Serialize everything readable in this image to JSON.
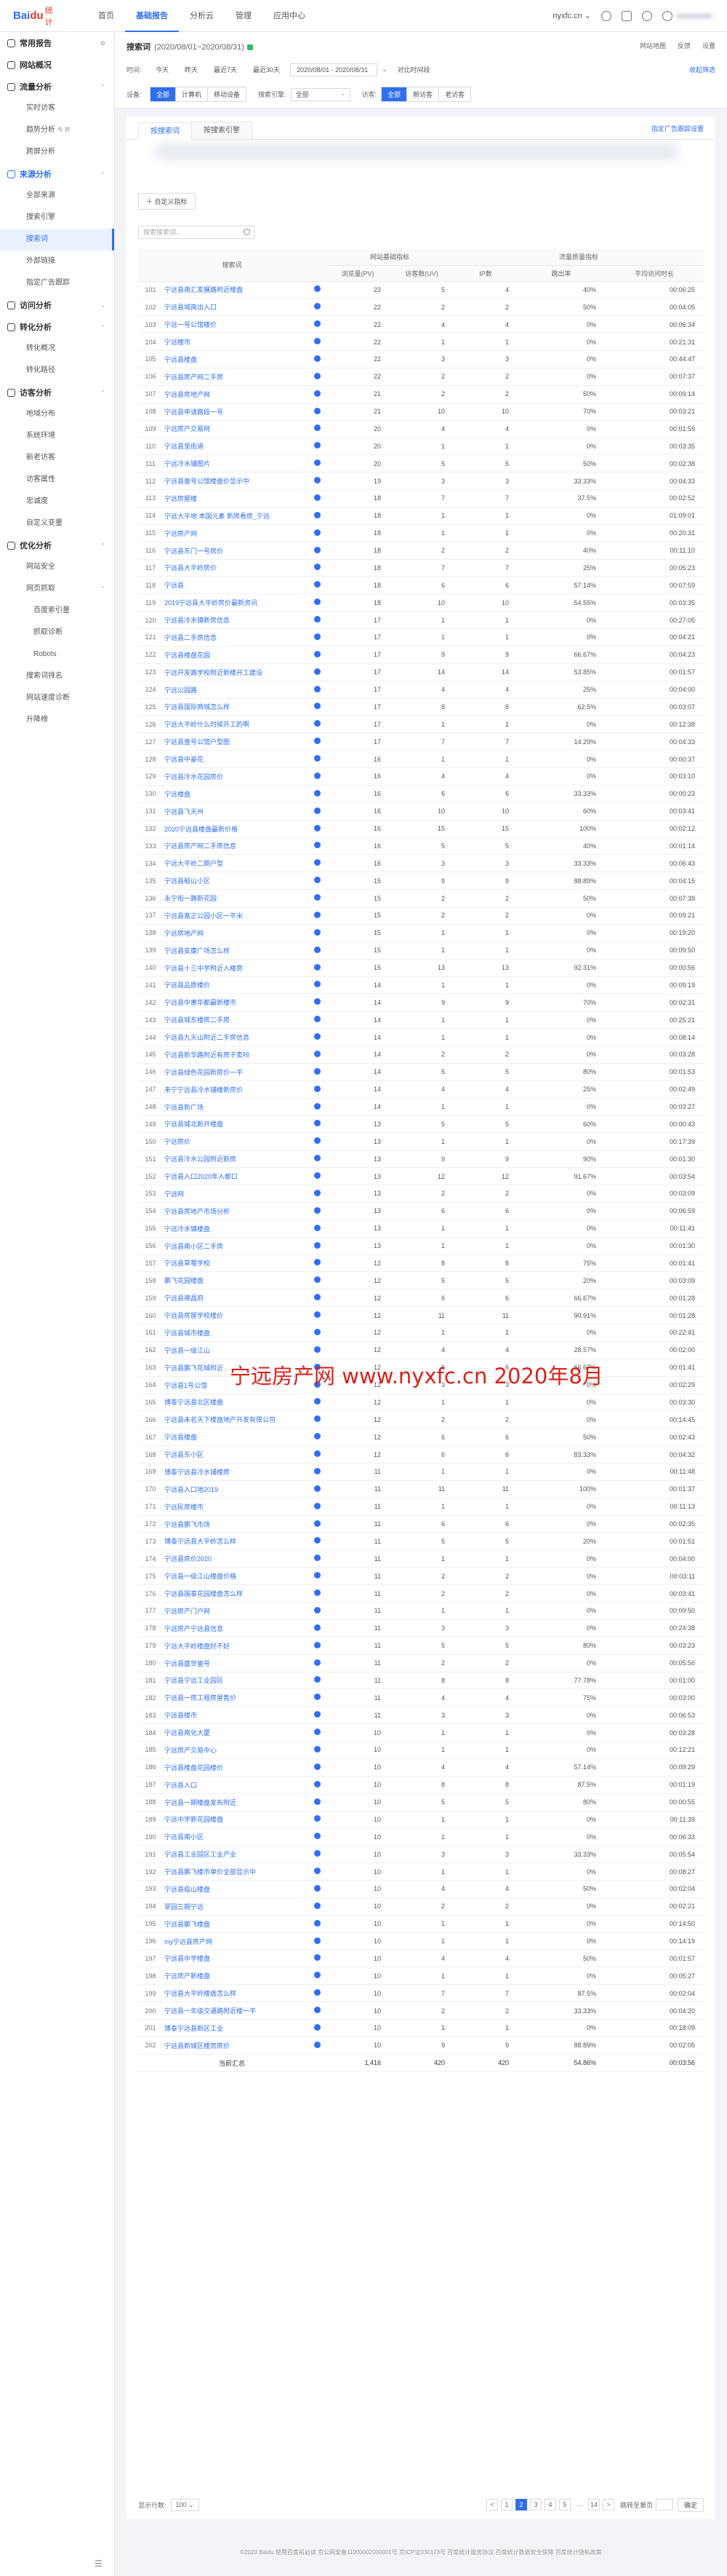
{
  "header": {
    "logo_text": "Bai",
    "logo_text2": "du",
    "logo_sub": "统计",
    "nav": [
      "首页",
      "基础报告",
      "分析云",
      "管理",
      "应用中心"
    ],
    "site": "nyxfc.cn",
    "accent": "#2f6ff0"
  },
  "sidebar": {
    "sections": [
      {
        "label": "常用报告",
        "items": []
      },
      {
        "label": "网站概况",
        "items": []
      },
      {
        "label": "流量分析",
        "items": [
          "实时访客",
          "趋势分析",
          "跨屏分析"
        ]
      },
      {
        "label": "来源分析",
        "items": [
          "全部来源",
          "搜索引擎",
          "搜索词",
          "外部链接",
          "指定广告跟踪"
        ]
      },
      {
        "label": "访问分析",
        "items": []
      },
      {
        "label": "转化分析",
        "items": [
          "转化概况",
          "转化路径"
        ]
      },
      {
        "label": "访客分析",
        "items": [
          "地域分布",
          "系统环境",
          "新老访客",
          "访客属性",
          "忠诚度",
          "自定义变量"
        ]
      },
      {
        "label": "优化分析",
        "items": [
          "网站安全",
          "网页抓取",
          "百度索引量",
          "抓取诊断",
          "Robots",
          "搜索词排名",
          "网站速度诊断",
          "升降榜"
        ]
      }
    ],
    "trend_badge": "今 昨"
  },
  "filter": {
    "title": "搜索词",
    "range": "(2020/08/01~2020/08/31)",
    "right_links": [
      "网站地图",
      "反馈",
      "设置"
    ],
    "time_label": "时间:",
    "time_chips": [
      "今天",
      "昨天",
      "最近7天",
      "最近30天"
    ],
    "date_value": "2020/08/01 - 2020/08/31",
    "compare": "对比时间段",
    "collapse": "收起筛选",
    "device_label": "设备:",
    "device_chips": [
      "全部",
      "计算机",
      "移动设备"
    ],
    "engine_label": "搜索引擎:",
    "engine_value": "全部",
    "visitor_label": "访客:",
    "visitor_chips": [
      "全部",
      "新访客",
      "老访客"
    ]
  },
  "tabs": [
    "按搜索词",
    "按搜索引擎"
  ],
  "tab_right": "指定广告跟踪设置",
  "export_button": "自定义指标",
  "search_placeholder": "搜索搜索词...",
  "table": {
    "group_headers": [
      "网站基础指标",
      "流量质量指标"
    ],
    "headers": [
      "搜索词",
      "浏览量(PV)",
      "访客数(UV)",
      "IP数",
      "跳出率",
      "平均访问时长"
    ],
    "rows": [
      [
        "101",
        "宁远县南汇发展路附近楼盘",
        "23",
        "5",
        "4",
        "40%",
        "00:06:25"
      ],
      [
        "102",
        "宁远县城南出入口",
        "22",
        "2",
        "2",
        "50%",
        "00:04:05"
      ],
      [
        "103",
        "宁远一号公馆楼价",
        "22",
        "4",
        "4",
        "0%",
        "00:06:34"
      ],
      [
        "104",
        "宁远楼市",
        "22",
        "1",
        "1",
        "0%",
        "00:21:31"
      ],
      [
        "105",
        "宁远县楼盘",
        "22",
        "3",
        "3",
        "0%",
        "00:44:47"
      ],
      [
        "106",
        "宁远县房产网二手房",
        "22",
        "2",
        "2",
        "0%",
        "00:07:37"
      ],
      [
        "107",
        "宁远县房地产网",
        "21",
        "2",
        "2",
        "50%",
        "00:09:14"
      ],
      [
        "108",
        "宁远县申请路段一号",
        "21",
        "10",
        "10",
        "70%",
        "00:03:21"
      ],
      [
        "109",
        "宁远房产交易网",
        "20",
        "4",
        "4",
        "0%",
        "00:01:59"
      ],
      [
        "110",
        "宁远县里街道",
        "20",
        "1",
        "1",
        "0%",
        "00:03:35"
      ],
      [
        "111",
        "宁远冷水铺图片",
        "20",
        "5",
        "5",
        "50%",
        "00:02:38"
      ],
      [
        "112",
        "宁远县壹号公馆楼盘价显示中",
        "19",
        "3",
        "3",
        "33.33%",
        "00:04:33"
      ],
      [
        "113",
        "宁远房屋楼",
        "18",
        "7",
        "7",
        "37.5%",
        "00:02:52"
      ],
      [
        "114",
        "宁远大平地 本国元素 新房看房_宁远",
        "18",
        "1",
        "1",
        "0%",
        "01:09:01"
      ],
      [
        "115",
        "宁远房产网",
        "18",
        "1",
        "1",
        "0%",
        "00:20:31"
      ],
      [
        "116",
        "宁远县东门一号房价",
        "18",
        "2",
        "2",
        "40%",
        "00:11:10"
      ],
      [
        "117",
        "宁远县大平岭房价",
        "18",
        "7",
        "7",
        "25%",
        "00:05:23"
      ],
      [
        "118",
        "宁远县",
        "18",
        "6",
        "6",
        "57.14%",
        "00:07:59"
      ],
      [
        "119",
        "2019宁远县大平岭房价最新资讯",
        "18",
        "10",
        "10",
        "54.55%",
        "00:03:35"
      ],
      [
        "120",
        "宁远县冷水镇新房信息",
        "17",
        "1",
        "1",
        "0%",
        "00:27:05"
      ],
      [
        "121",
        "宁远县二手房信息",
        "17",
        "1",
        "1",
        "0%",
        "00:04:21"
      ],
      [
        "122",
        "宁远县楼盘花园",
        "17",
        "9",
        "9",
        "66.67%",
        "00:04:23"
      ],
      [
        "123",
        "宁远开发路学校附近新楼开工建设",
        "17",
        "14",
        "14",
        "53.85%",
        "00:01:57"
      ],
      [
        "124",
        "宁远公园路",
        "17",
        "4",
        "4",
        "25%",
        "00:04:00"
      ],
      [
        "125",
        "宁远县国际商城怎么样",
        "17",
        "8",
        "8",
        "62.5%",
        "00:03:07"
      ],
      [
        "126",
        "宁远大平岭什么时候开工的啊",
        "17",
        "1",
        "1",
        "0%",
        "00:12:38"
      ],
      [
        "127",
        "宁远县壹号公馆户型图",
        "17",
        "7",
        "7",
        "14.29%",
        "00:04:33"
      ],
      [
        "128",
        "宁远县中豪花",
        "16",
        "1",
        "1",
        "0%",
        "00:00:37"
      ],
      [
        "129",
        "宁远县冷水花园房价",
        "16",
        "4",
        "4",
        "0%",
        "00:03:10"
      ],
      [
        "130",
        "宁远楼盘",
        "16",
        "6",
        "6",
        "33.33%",
        "00:00:23"
      ],
      [
        "131",
        "宁远县飞天州",
        "16",
        "10",
        "10",
        "60%",
        "00:03:41"
      ],
      [
        "132",
        "2020宁远县楼盘最新价格",
        "16",
        "15",
        "15",
        "100%",
        "00:02:12"
      ],
      [
        "133",
        "宁远县房产网二手房信息",
        "16",
        "5",
        "5",
        "40%",
        "00:01:14"
      ],
      [
        "134",
        "宁远大平岭二期户型",
        "16",
        "3",
        "3",
        "33.33%",
        "00:06:43"
      ],
      [
        "135",
        "宁远县船山小区",
        "15",
        "9",
        "9",
        "88.89%",
        "00:04:15"
      ],
      [
        "136",
        "永宁街一路新花园",
        "15",
        "2",
        "2",
        "50%",
        "00:07:39"
      ],
      [
        "137",
        "宁远县富正公园小区一平米",
        "15",
        "2",
        "2",
        "0%",
        "00:09:21"
      ],
      [
        "138",
        "宁远房地产网",
        "15",
        "1",
        "1",
        "0%",
        "00:19:20"
      ],
      [
        "139",
        "宁远县安康广场怎么样",
        "15",
        "1",
        "1",
        "0%",
        "00:09:50"
      ],
      [
        "140",
        "宁远县十三中学附近入楼房",
        "15",
        "13",
        "13",
        "92.31%",
        "00:00:56"
      ],
      [
        "141",
        "宁远县品质楼价",
        "14",
        "1",
        "1",
        "0%",
        "00:09:19"
      ],
      [
        "142",
        "宁远县中惠华都最新楼市",
        "14",
        "9",
        "9",
        "70%",
        "00:02:31"
      ],
      [
        "143",
        "宁远县城东楼房二手房",
        "14",
        "1",
        "1",
        "0%",
        "00:25:21"
      ],
      [
        "144",
        "宁远县九天山附近二手房信息",
        "14",
        "1",
        "1",
        "0%",
        "00:08:14"
      ],
      [
        "145",
        "宁远县新华路附近有房子卖吗",
        "14",
        "2",
        "2",
        "0%",
        "00:03:28"
      ],
      [
        "146",
        "宁远县绿色花园新房价一平",
        "14",
        "5",
        "5",
        "80%",
        "00:01:53"
      ],
      [
        "147",
        "来宁宁远县冷水铺楼新房价",
        "14",
        "4",
        "4",
        "25%",
        "00:02:49"
      ],
      [
        "148",
        "宁远县新广场",
        "14",
        "1",
        "1",
        "0%",
        "00:03:27"
      ],
      [
        "149",
        "宁远县城北新开楼盘",
        "13",
        "5",
        "5",
        "60%",
        "00:00:43"
      ],
      [
        "150",
        "宁远房价",
        "13",
        "1",
        "1",
        "0%",
        "00:17:39"
      ],
      [
        "151",
        "宁远县冷水公园附近新房",
        "13",
        "9",
        "9",
        "90%",
        "00:01:30"
      ],
      [
        "152",
        "宁远县入口2020年入都口",
        "13",
        "12",
        "12",
        "91.67%",
        "00:03:54"
      ],
      [
        "153",
        "宁远网",
        "13",
        "2",
        "2",
        "0%",
        "00:03:09"
      ],
      [
        "154",
        "宁远县房地产市场分析",
        "13",
        "6",
        "6",
        "0%",
        "00:06:59"
      ],
      [
        "155",
        "宁远冷水镇楼盘",
        "13",
        "1",
        "1",
        "0%",
        "00:11:41"
      ],
      [
        "156",
        "宁远县南小区二手房",
        "13",
        "1",
        "1",
        "0%",
        "00:01:30"
      ],
      [
        "157",
        "宁远县草莓学校",
        "12",
        "8",
        "8",
        "75%",
        "00:01:41"
      ],
      [
        "158",
        "鹏飞花园楼盘",
        "12",
        "5",
        "5",
        "20%",
        "00:03:09"
      ],
      [
        "159",
        "宁远县德昌府",
        "12",
        "6",
        "6",
        "66.67%",
        "00:01:28"
      ],
      [
        "160",
        "宁远县房屋学校楼价",
        "12",
        "11",
        "11",
        "90.91%",
        "00:01:28"
      ],
      [
        "161",
        "宁远县城市楼盘",
        "12",
        "1",
        "1",
        "0%",
        "00:22:41"
      ],
      [
        "162",
        "宁远县一级江山",
        "12",
        "4",
        "4",
        "28.57%",
        "00:02:00"
      ],
      [
        "163",
        "宁远县鹏飞花城附近",
        "12",
        "6",
        "6",
        "66.67%",
        "00:01:41"
      ],
      [
        "164",
        "宁远县1号公馆",
        "12",
        "3",
        "3",
        "0%",
        "00:02:29"
      ],
      [
        "165",
        "博泰宁远县北区楼盘",
        "12",
        "1",
        "1",
        "0%",
        "00:03:30"
      ],
      [
        "166",
        "宁远县未名天下楼盘地产开发有限公司",
        "12",
        "2",
        "2",
        "0%",
        "00:14:45"
      ],
      [
        "167",
        "宁远县楼盘",
        "12",
        "6",
        "6",
        "50%",
        "00:02:43"
      ],
      [
        "168",
        "宁远县东小区",
        "12",
        "6",
        "6",
        "83.33%",
        "00:04:32"
      ],
      [
        "169",
        "博泰宁远县冷水铺楼房",
        "11",
        "1",
        "1",
        "0%",
        "00:11:48"
      ],
      [
        "170",
        "宁远县入口地2019",
        "11",
        "11",
        "11",
        "100%",
        "00:01:37"
      ],
      [
        "171",
        "宁远民房楼市",
        "11",
        "1",
        "1",
        "0%",
        "00:11:13"
      ],
      [
        "172",
        "宁远县鹏飞市场",
        "11",
        "6",
        "6",
        "0%",
        "00:02:35"
      ],
      [
        "173",
        "博泰宁远县大平岭怎么样",
        "11",
        "5",
        "5",
        "20%",
        "00:01:51"
      ],
      [
        "174",
        "宁远县房价2020",
        "11",
        "1",
        "1",
        "0%",
        "00:04:00"
      ],
      [
        "175",
        "宁远县一级江山楼盘价格",
        "11",
        "2",
        "2",
        "0%",
        "00:03:11"
      ],
      [
        "176",
        "宁远县国泰花园楼盘怎么样",
        "11",
        "2",
        "2",
        "0%",
        "00:03:41"
      ],
      [
        "177",
        "宁远房产门户网",
        "11",
        "1",
        "1",
        "0%",
        "00:09:50"
      ],
      [
        "178",
        "宁远房产宁远县信息",
        "11",
        "3",
        "3",
        "0%",
        "00:24:38"
      ],
      [
        "179",
        "宁远大平岭楼盘好不好",
        "11",
        "5",
        "5",
        "80%",
        "00:03:23"
      ],
      [
        "180",
        "宁远县盛世壹号",
        "11",
        "2",
        "2",
        "0%",
        "00:05:56"
      ],
      [
        "181",
        "宁远县宁远工业园区",
        "11",
        "8",
        "8",
        "77.78%",
        "00:01:00"
      ],
      [
        "182",
        "宁远县一房工程房屋售价",
        "11",
        "4",
        "4",
        "75%",
        "00:03:00"
      ],
      [
        "183",
        "宁远县楼市",
        "11",
        "3",
        "3",
        "0%",
        "00:06:53"
      ],
      [
        "184",
        "宁远县南化大厦",
        "10",
        "1",
        "1",
        "0%",
        "00:03:28"
      ],
      [
        "185",
        "宁远房产交易中心",
        "10",
        "1",
        "1",
        "0%",
        "00:12:21"
      ],
      [
        "186",
        "宁远县楼盘花园楼价",
        "10",
        "4",
        "4",
        "57.14%",
        "00:09:29"
      ],
      [
        "187",
        "宁远县入口",
        "10",
        "8",
        "8",
        "87.5%",
        "00:01:19"
      ],
      [
        "188",
        "宁远县一期楼盘发布附近",
        "10",
        "5",
        "5",
        "80%",
        "00:00:55"
      ],
      [
        "189",
        "宁远中学新花园楼盘",
        "10",
        "1",
        "1",
        "0%",
        "00:11:39"
      ],
      [
        "190",
        "宁远县南小区",
        "10",
        "1",
        "1",
        "0%",
        "00:06:33"
      ],
      [
        "191",
        "宁远县工业园区工业产业",
        "10",
        "3",
        "3",
        "33.33%",
        "00:05:54"
      ],
      [
        "192",
        "宁远县鹏飞楼市单价全部显示中",
        "10",
        "1",
        "1",
        "0%",
        "00:08:27"
      ],
      [
        "193",
        "宁远县临山楼盘",
        "10",
        "4",
        "4",
        "50%",
        "00:02:04"
      ],
      [
        "194",
        "翠园三期宁远",
        "10",
        "2",
        "2",
        "0%",
        "00:02:21"
      ],
      [
        "195",
        "宁远县鹏飞楼盘",
        "10",
        "1",
        "1",
        "0%",
        "00:14:50"
      ],
      [
        "196",
        "my宁远县房产网",
        "10",
        "1",
        "1",
        "0%",
        "00:14:19"
      ],
      [
        "197",
        "宁远县中学楼盘",
        "10",
        "4",
        "4",
        "50%",
        "00:01:57"
      ],
      [
        "198",
        "宁远房产新楼盘",
        "10",
        "1",
        "1",
        "0%",
        "00:05:27"
      ],
      [
        "199",
        "宁远县大平岭楼盘怎么样",
        "10",
        "7",
        "7",
        "87.5%",
        "00:02:04"
      ],
      [
        "200",
        "宁远县一年级交通路附近楼一平",
        "10",
        "2",
        "2",
        "33.33%",
        "00:04:20"
      ],
      [
        "201",
        "博泰宁远县新区工业",
        "10",
        "1",
        "1",
        "0%",
        "00:18:09"
      ],
      [
        "202",
        "宁远县新城区楼房房价",
        "10",
        "9",
        "9",
        "88.89%",
        "00:02:05"
      ]
    ],
    "total": [
      "当前汇总",
      "1,416",
      "420",
      "420",
      "54.86%",
      "00:03:56"
    ]
  },
  "pager": {
    "size_label": "显示行数:",
    "size_value": "100",
    "pages": [
      "<",
      "1",
      "2",
      "3",
      "4",
      "5",
      "…",
      "14",
      ">"
    ],
    "current": "2",
    "goto_label": "跳转至第页",
    "goto_button": "确定"
  },
  "watermark": "宁远房产网 www.nyxfc.cn 2020年8月",
  "footer": "©2020 Baidu 使用百度前必读 京公网安备11000002000001号 京ICP证030173号 百度统计服务协议 百度统计数据安全保障 百度统计隐私政策"
}
